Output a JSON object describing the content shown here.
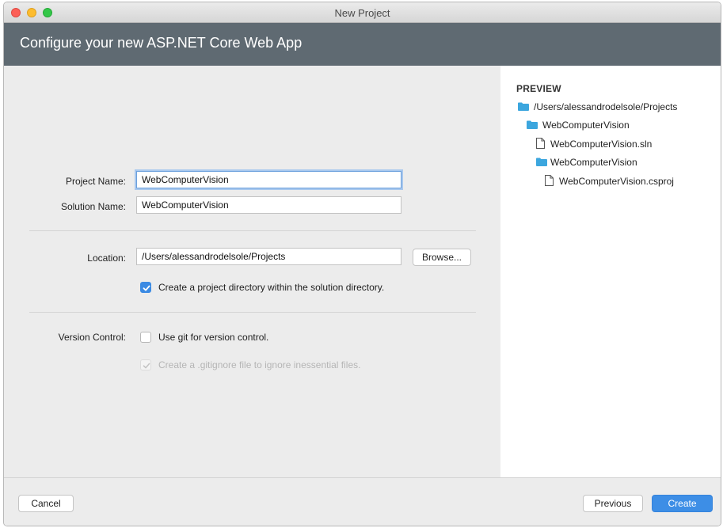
{
  "window": {
    "title": "New Project"
  },
  "header": {
    "title": "Configure your new ASP.NET Core Web App"
  },
  "form": {
    "project_name": {
      "label": "Project Name:",
      "value": "WebComputerVision"
    },
    "solution_name": {
      "label": "Solution Name:",
      "value": "WebComputerVision"
    },
    "location": {
      "label": "Location:",
      "value": "/Users/alessandrodelsole/Projects",
      "browse_label": "Browse..."
    },
    "create_dir": {
      "label": "Create a project directory within the solution directory.",
      "checked": true
    },
    "version_control": {
      "label": "Version Control:",
      "use_git": {
        "label": "Use git for version control.",
        "checked": false
      },
      "gitignore": {
        "label": "Create a .gitignore file to ignore inessential files.",
        "checked": true,
        "disabled": true
      }
    }
  },
  "preview": {
    "heading": "PREVIEW",
    "tree": [
      {
        "label": "/Users/alessandrodelsole/Projects",
        "icon": "folder-icon"
      },
      {
        "label": "WebComputerVision",
        "icon": "folder-icon"
      },
      {
        "label": "WebComputerVision.sln",
        "icon": "file-icon"
      },
      {
        "label": "WebComputerVision",
        "icon": "folder-icon"
      },
      {
        "label": "WebComputerVision.csproj",
        "icon": "file-icon"
      }
    ]
  },
  "footer": {
    "cancel_label": "Cancel",
    "previous_label": "Previous",
    "create_label": "Create"
  },
  "colors": {
    "header_bg": "#5f6a72",
    "accent": "#3d8ee6",
    "folder": "#3ca6de"
  }
}
